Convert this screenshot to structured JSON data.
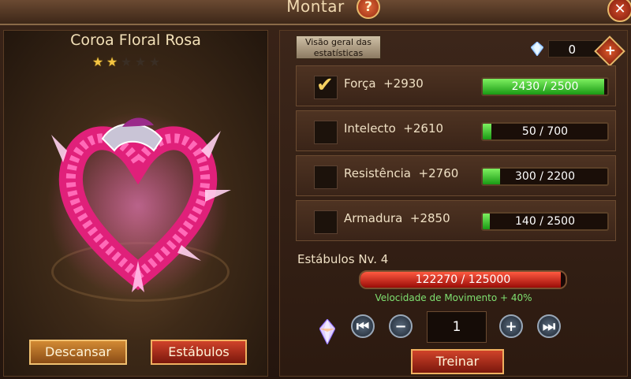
{
  "window": {
    "title": "Montar",
    "help_icon": "question-icon",
    "close_icon": "close-icon"
  },
  "mount": {
    "name": "Coroa Floral Rosa",
    "stars_total": 5,
    "stars_filled": 2
  },
  "actions": {
    "rest_label": "Descansar",
    "stables_label": "Estábulos"
  },
  "stats_overview": {
    "button_label": "Visão geral das estatísticas"
  },
  "currency": {
    "icon": "crystal-icon",
    "value": "0",
    "add_icon": "plus-icon"
  },
  "stats": [
    {
      "name": "Força",
      "bonus": "+2930",
      "checked": true,
      "progress_text": "2430 / 2500",
      "current": 2430,
      "max": 2500
    },
    {
      "name": "Intelecto",
      "bonus": "+2610",
      "checked": false,
      "progress_text": "50 / 700",
      "current": 50,
      "max": 700
    },
    {
      "name": "Resistência",
      "bonus": "+2760",
      "checked": false,
      "progress_text": "300 / 2200",
      "current": 300,
      "max": 2200
    },
    {
      "name": "Armadura",
      "bonus": "+2850",
      "checked": false,
      "progress_text": "140 / 2500",
      "current": 140,
      "max": 2500
    }
  ],
  "stables": {
    "level_label": "Estábulos Nv. 4",
    "progress_text": "122270 / 125000",
    "current": 122270,
    "max": 125000,
    "speed_text": "Velocidade de Movimento + 40%"
  },
  "training": {
    "quantity": "1",
    "train_label": "Treinar",
    "icons": [
      "crystal-icon",
      "skip-first-icon",
      "minus-icon",
      "plus-icon",
      "skip-last-icon"
    ]
  },
  "colors": {
    "accent_gold": "#e8b96a",
    "progress_green": "#1a9a14",
    "progress_red": "#9a0c08",
    "speed_green": "#7fe070"
  }
}
